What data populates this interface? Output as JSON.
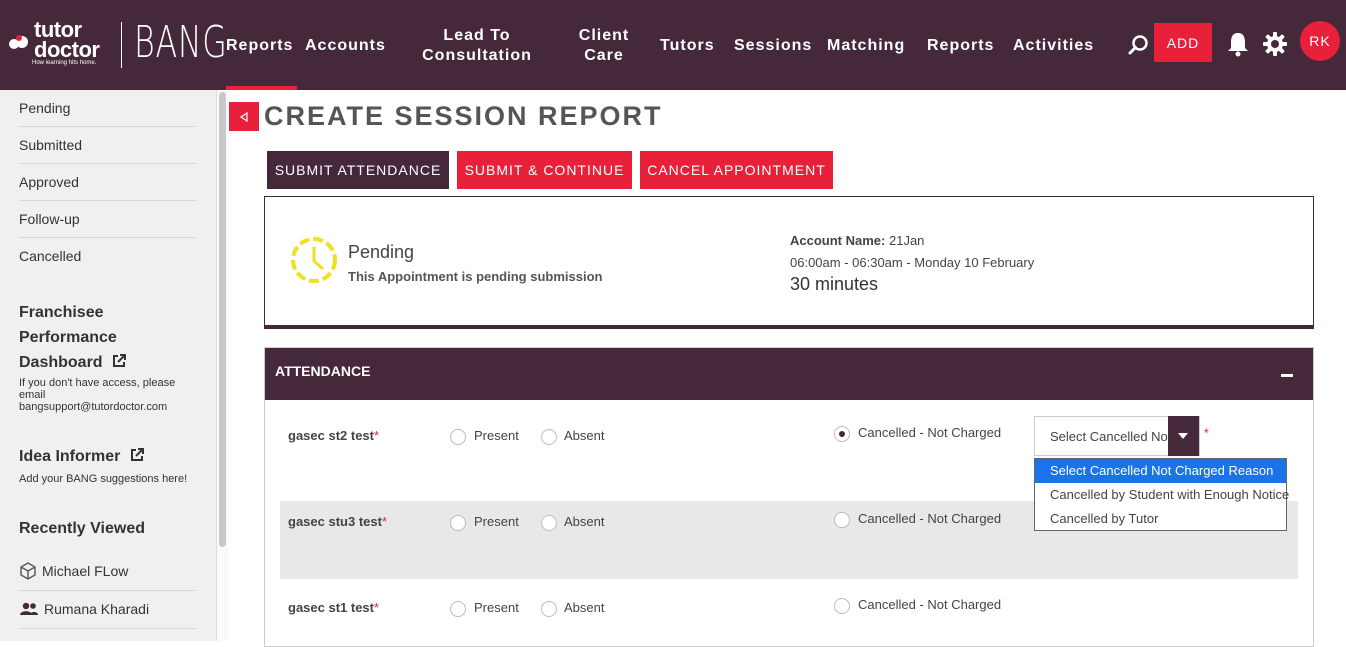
{
  "brand": {
    "logo_name": "tutor doctor",
    "logo_tagline": "How learning hits home.",
    "app_name": "BANG"
  },
  "nav": {
    "items": [
      {
        "label": "Reports"
      },
      {
        "label": "Accounts"
      },
      {
        "label": "Lead To Consultation"
      },
      {
        "label": "Client Care"
      },
      {
        "label": "Tutors"
      },
      {
        "label": "Sessions"
      },
      {
        "label": "Matching"
      },
      {
        "label": "Reports"
      },
      {
        "label": "Activities"
      }
    ],
    "add_label": "ADD",
    "avatar_initials": "RK",
    "accent_color": "#e8203a",
    "bar_color": "#45283a"
  },
  "sidebar": {
    "items": [
      {
        "label": "Pending"
      },
      {
        "label": "Submitted"
      },
      {
        "label": "Approved"
      },
      {
        "label": "Follow-up"
      },
      {
        "label": "Cancelled"
      }
    ],
    "franchisee": {
      "line1": "Franchisee",
      "line2": "Performance",
      "line3": "Dashboard",
      "note1": "If you don't have access, please",
      "note2": "email",
      "note3": "bangsupport@tutordoctor.com"
    },
    "idea": {
      "title": "Idea Informer",
      "note": "Add your BANG suggestions here!"
    },
    "recent": {
      "title": "Recently Viewed",
      "items": [
        {
          "label": "Michael FLow",
          "icon": "cube-icon"
        },
        {
          "label": "Rumana Kharadi",
          "icon": "people-icon"
        }
      ]
    }
  },
  "page": {
    "title": "CREATE SESSION REPORT",
    "buttons": {
      "submit_attendance": "SUBMIT ATTENDANCE",
      "submit_continue": "SUBMIT & CONTINUE",
      "cancel_appointment": "CANCEL APPOINTMENT"
    }
  },
  "status": {
    "title": "Pending",
    "subtitle": "This Appointment is pending submission",
    "account_label": "Account Name:",
    "account_value": "21Jan",
    "time": "06:00am - 06:30am - Monday 10 February",
    "duration": "30 minutes"
  },
  "attendance": {
    "title": "ATTENDANCE",
    "options": {
      "present": "Present",
      "absent": "Absent",
      "cancelled": "Cancelled - Not Charged"
    },
    "students": [
      {
        "name": "gasec st2 test",
        "selected": "cancelled"
      },
      {
        "name": "gasec stu3 test",
        "selected": "none"
      },
      {
        "name": "gasec st1 test",
        "selected": "none"
      }
    ],
    "select": {
      "value": "Select Cancelled Not Charged Reason",
      "options": [
        "Select Cancelled Not Charged Reason",
        "Cancelled by Student with Enough Notice",
        "Cancelled by Tutor"
      ]
    }
  }
}
